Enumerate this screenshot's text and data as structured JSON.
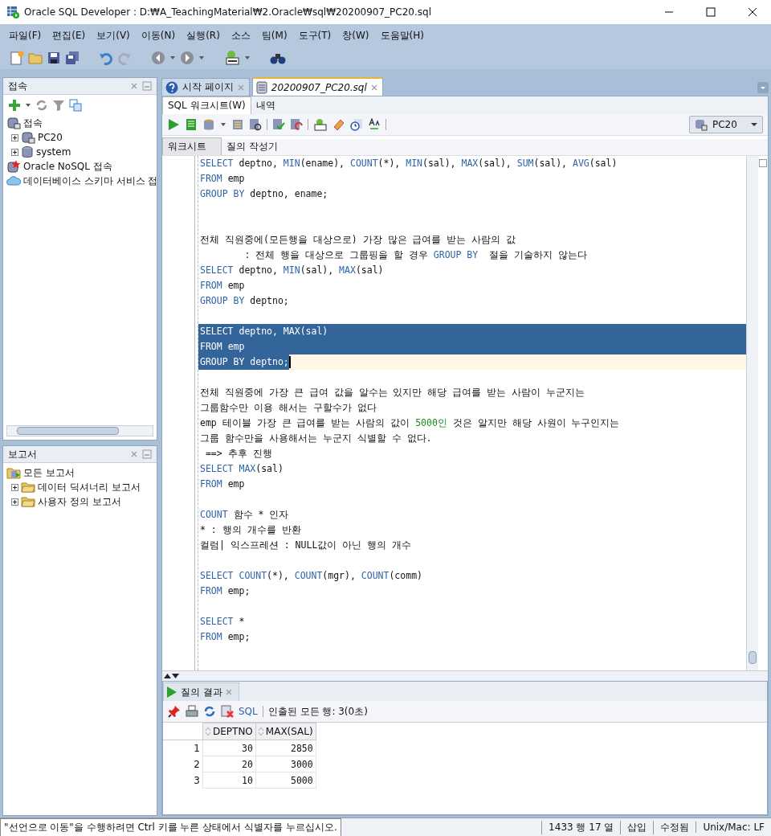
{
  "window": {
    "title": "Oracle SQL Developer : D:₩A_TeachingMaterial₩2.Oracle₩sql₩20200907_PC20.sql"
  },
  "menu": [
    "파일(F)",
    "편집(E)",
    "보기(V)",
    "이동(N)",
    "실행(R)",
    "소스",
    "팀(M)",
    "도구(T)",
    "창(W)",
    "도움말(H)"
  ],
  "connections_panel": {
    "title": "접속",
    "tree": [
      {
        "label": "접속",
        "kind": "connections",
        "children": [
          {
            "label": "PC20",
            "kind": "connection",
            "expanded": false
          },
          {
            "label": "system",
            "kind": "database",
            "expanded": false
          }
        ]
      },
      {
        "label": "Oracle NoSQL 접속",
        "kind": "nosql"
      },
      {
        "label": "데이터베이스 스키마 서비스 접",
        "kind": "cloud"
      }
    ]
  },
  "reports_panel": {
    "title": "보고서",
    "tree": [
      {
        "label": "모든 보고서",
        "kind": "reports",
        "children": [
          {
            "label": "데이터 딕셔너리 보고서",
            "kind": "folder",
            "expanded": false
          },
          {
            "label": "사용자 정의 보고서",
            "kind": "folder",
            "expanded": false
          }
        ]
      }
    ]
  },
  "editor_tabs": [
    {
      "label": "시작 페이지",
      "kind": "help",
      "selected": false
    },
    {
      "label": "20200907_PC20.sql",
      "kind": "sql",
      "selected": true
    }
  ],
  "sub_tabs": [
    {
      "label": "SQL 워크시트(W)",
      "selected": true
    },
    {
      "label": "내역",
      "selected": false
    }
  ],
  "connection_select": {
    "value": "PC20"
  },
  "worksheet_tabs": [
    {
      "label": "워크시트",
      "selected": true
    },
    {
      "label": "질의 작성기",
      "selected": false
    }
  ],
  "editor_lines": [
    {
      "kind": "code",
      "selected": false,
      "current": false,
      "segments": [
        {
          "kind": "kw",
          "text": "SELECT"
        },
        {
          "kind": "text",
          "text": " deptno, "
        },
        {
          "kind": "kw",
          "text": "MIN"
        },
        {
          "kind": "text",
          "text": "(ename), "
        },
        {
          "kind": "kw",
          "text": "COUNT"
        },
        {
          "kind": "text",
          "text": "(*), "
        },
        {
          "kind": "kw",
          "text": "MIN"
        },
        {
          "kind": "text",
          "text": "(sal), "
        },
        {
          "kind": "kw",
          "text": "MAX"
        },
        {
          "kind": "text",
          "text": "(sal), "
        },
        {
          "kind": "kw",
          "text": "SUM"
        },
        {
          "kind": "text",
          "text": "(sal), "
        },
        {
          "kind": "kw",
          "text": "AVG"
        },
        {
          "kind": "text",
          "text": "(sal)"
        }
      ]
    },
    {
      "kind": "code",
      "selected": false,
      "current": false,
      "segments": [
        {
          "kind": "kw",
          "text": "FROM"
        },
        {
          "kind": "text",
          "text": " emp"
        }
      ]
    },
    {
      "kind": "code",
      "selected": false,
      "current": false,
      "segments": [
        {
          "kind": "kw",
          "text": "GROUP BY"
        },
        {
          "kind": "text",
          "text": " deptno, ename;"
        }
      ]
    },
    {
      "kind": "blank"
    },
    {
      "kind": "blank"
    },
    {
      "kind": "code",
      "selected": false,
      "current": false,
      "segments": [
        {
          "kind": "text",
          "text": "전체 직원중에(모든행을 대상으로) 가장 많은 급여를 받는 사람의 값"
        }
      ]
    },
    {
      "kind": "code",
      "selected": false,
      "current": false,
      "segments": [
        {
          "kind": "text",
          "text": "        : 전체 행을 대상으로 그룹핑을 할 경우 "
        },
        {
          "kind": "kw",
          "text": "GROUP BY"
        },
        {
          "kind": "text",
          "text": "  절을 기술하지 않는다"
        }
      ]
    },
    {
      "kind": "code",
      "selected": false,
      "current": false,
      "segments": [
        {
          "kind": "kw",
          "text": "SELECT"
        },
        {
          "kind": "text",
          "text": " deptno, "
        },
        {
          "kind": "kw",
          "text": "MIN"
        },
        {
          "kind": "text",
          "text": "(sal), "
        },
        {
          "kind": "kw",
          "text": "MAX"
        },
        {
          "kind": "text",
          "text": "(sal)"
        }
      ]
    },
    {
      "kind": "code",
      "selected": false,
      "current": false,
      "segments": [
        {
          "kind": "kw",
          "text": "FROM"
        },
        {
          "kind": "text",
          "text": " emp"
        }
      ]
    },
    {
      "kind": "code",
      "selected": false,
      "current": false,
      "segments": [
        {
          "kind": "kw",
          "text": "GROUP BY"
        },
        {
          "kind": "text",
          "text": " deptno;"
        }
      ]
    },
    {
      "kind": "blank"
    },
    {
      "kind": "code",
      "selected": true,
      "current": false,
      "segments": [
        {
          "kind": "kw",
          "text": "SELECT"
        },
        {
          "kind": "text",
          "text": " deptno, "
        },
        {
          "kind": "kw",
          "text": "MAX"
        },
        {
          "kind": "text",
          "text": "(sal)"
        }
      ]
    },
    {
      "kind": "code",
      "selected": true,
      "current": false,
      "segments": [
        {
          "kind": "kw",
          "text": "FROM"
        },
        {
          "kind": "text",
          "text": " emp"
        }
      ]
    },
    {
      "kind": "code",
      "selected": true,
      "current": true,
      "segments": [
        {
          "kind": "kw",
          "text": "GROUP BY"
        },
        {
          "kind": "text",
          "text": " deptno;"
        }
      ]
    },
    {
      "kind": "blank"
    },
    {
      "kind": "code",
      "selected": false,
      "current": false,
      "segments": [
        {
          "kind": "text",
          "text": "전체 직원중에 가장 큰 급여 값을 알수는 있지만 해당 급여를 받는 사람이 누군지는"
        }
      ]
    },
    {
      "kind": "code",
      "selected": false,
      "current": false,
      "segments": [
        {
          "kind": "text",
          "text": "그룹함수만 이용 해서는 구할수가 없다"
        }
      ]
    },
    {
      "kind": "code",
      "selected": false,
      "current": false,
      "segments": [
        {
          "kind": "text",
          "text": "emp 테이블 가장 큰 급여를 받는 사람의 값이 "
        },
        {
          "kind": "num",
          "text": "5000인"
        },
        {
          "kind": "text",
          "text": " 것은 알지만 해당 사원이 누구인지는"
        }
      ]
    },
    {
      "kind": "code",
      "selected": false,
      "current": false,
      "segments": [
        {
          "kind": "text",
          "text": "그룹 함수만을 사용해서는 누군지 식별할 수 없다."
        }
      ]
    },
    {
      "kind": "code",
      "selected": false,
      "current": false,
      "segments": [
        {
          "kind": "text",
          "text": " ==> 추후 진행"
        }
      ]
    },
    {
      "kind": "code",
      "selected": false,
      "current": false,
      "segments": [
        {
          "kind": "kw",
          "text": "SELECT"
        },
        {
          "kind": "kw",
          "text": " MAX"
        },
        {
          "kind": "text",
          "text": "(sal)"
        }
      ]
    },
    {
      "kind": "code",
      "selected": false,
      "current": false,
      "segments": [
        {
          "kind": "kw",
          "text": "FROM"
        },
        {
          "kind": "text",
          "text": " emp"
        }
      ]
    },
    {
      "kind": "blank"
    },
    {
      "kind": "code",
      "selected": false,
      "current": false,
      "segments": [
        {
          "kind": "kw",
          "text": "COUNT"
        },
        {
          "kind": "text",
          "text": " 함수 * 인자"
        }
      ]
    },
    {
      "kind": "code",
      "selected": false,
      "current": false,
      "segments": [
        {
          "kind": "text",
          "text": "* : 행의 개수를 반환"
        }
      ]
    },
    {
      "kind": "code",
      "selected": false,
      "current": false,
      "segments": [
        {
          "kind": "text",
          "text": "컬럼| 익스프레션 : NULL값이 아닌 행의 개수"
        }
      ]
    },
    {
      "kind": "blank"
    },
    {
      "kind": "code",
      "selected": false,
      "current": false,
      "segments": [
        {
          "kind": "kw",
          "text": "SELECT"
        },
        {
          "kind": "kw",
          "text": " COUNT"
        },
        {
          "kind": "text",
          "text": "(*), "
        },
        {
          "kind": "kw",
          "text": "COUNT"
        },
        {
          "kind": "text",
          "text": "(mgr), "
        },
        {
          "kind": "kw",
          "text": "COUNT"
        },
        {
          "kind": "text",
          "text": "(comm)"
        }
      ]
    },
    {
      "kind": "code",
      "selected": false,
      "current": false,
      "segments": [
        {
          "kind": "kw",
          "text": "FROM"
        },
        {
          "kind": "text",
          "text": " emp;"
        }
      ]
    },
    {
      "kind": "blank"
    },
    {
      "kind": "code",
      "selected": false,
      "current": false,
      "segments": [
        {
          "kind": "kw",
          "text": "SELECT"
        },
        {
          "kind": "text",
          "text": " *"
        }
      ]
    },
    {
      "kind": "code",
      "selected": false,
      "current": false,
      "segments": [
        {
          "kind": "kw",
          "text": "FROM"
        },
        {
          "kind": "text",
          "text": " emp;"
        }
      ]
    }
  ],
  "results": {
    "tab": "질의 결과",
    "sql_link": "SQL",
    "status": "인출된 모든 행: 3(0초)",
    "columns": [
      "DEPTNO",
      "MAX(SAL)"
    ],
    "rows": [
      {
        "number": "1",
        "cells": [
          "30",
          "2850"
        ]
      },
      {
        "number": "2",
        "cells": [
          "20",
          "3000"
        ]
      },
      {
        "number": "3",
        "cells": [
          "10",
          "5000"
        ]
      }
    ]
  },
  "status_bar": {
    "message": "\"선언으로 이동\"을 수행하려면 Ctrl 키를 누른 상태에서 식별자를 누르십시오.",
    "position": "1433 행 17 열",
    "mode": "삽입",
    "state": "수정됨",
    "line_ending": "Unix/Mac: LF"
  }
}
